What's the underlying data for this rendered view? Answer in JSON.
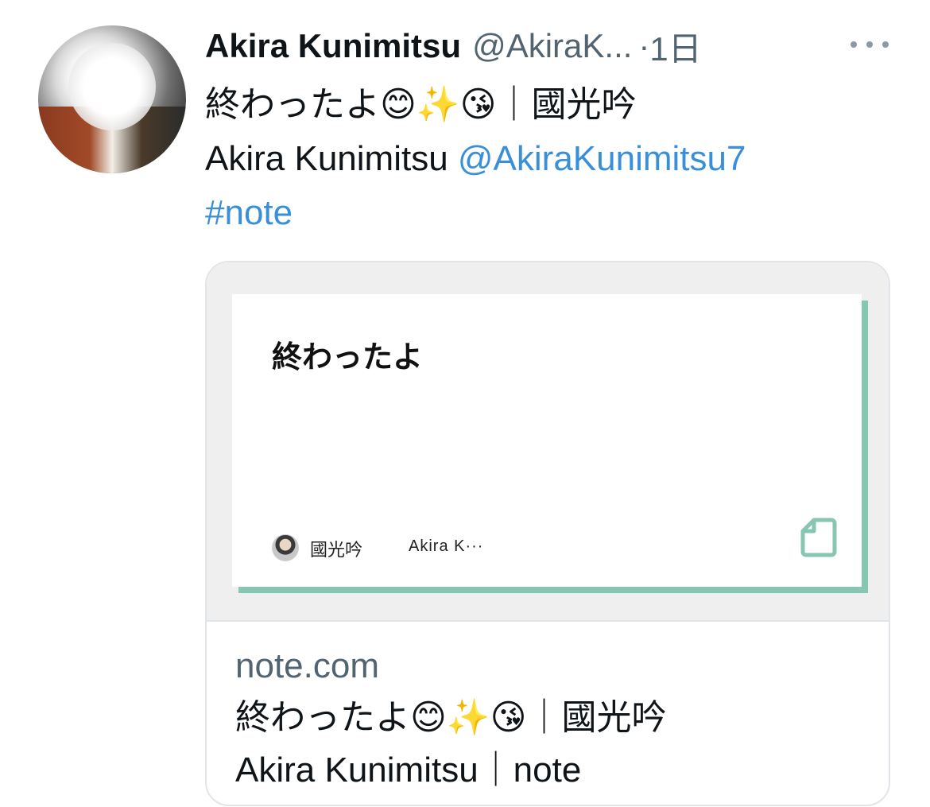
{
  "tweet": {
    "display_name": "Akira Kunimitsu",
    "handle": "@AkiraK...",
    "separator": "·",
    "time": "1日",
    "text_line1": "終わったよ😊✨😘｜國光吟",
    "text_line2_plain": "Akira  Kunimitsu ",
    "text_line2_mention": "@AkiraKunimitsu7",
    "text_line3_hashtag": "#note"
  },
  "card": {
    "note_title": "終わったよ",
    "note_author": "國光吟",
    "note_author_sub": "Akira K···",
    "domain": "note.com",
    "title_line1": "終わったよ😊✨😘｜國光吟",
    "title_line2": "Akira Kunimitsu｜note"
  },
  "icons": {
    "more": "more-horizontal-icon",
    "note_doc": "note-document-icon"
  },
  "colors": {
    "link": "#3a8fd9",
    "note_accent": "#86c6b3",
    "secondary_text": "#536471"
  }
}
